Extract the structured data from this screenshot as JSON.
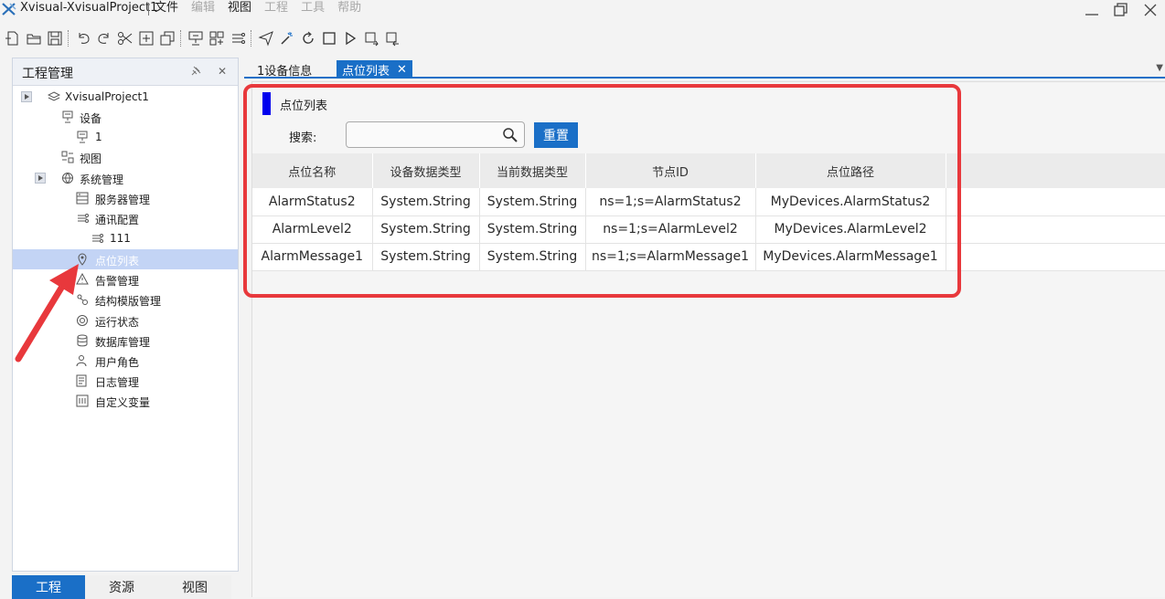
{
  "window": {
    "title": "Xvisual-XvisualProject1",
    "menus": [
      {
        "label": "文件",
        "enabled": true
      },
      {
        "label": "编辑",
        "enabled": false
      },
      {
        "label": "视图",
        "enabled": true
      },
      {
        "label": "工程",
        "enabled": false
      },
      {
        "label": "工具",
        "enabled": false
      },
      {
        "label": "帮助",
        "enabled": false
      }
    ]
  },
  "left_panel": {
    "title": "工程管理",
    "tree": [
      {
        "label": "XvisualProject1",
        "icon": "layers-icon",
        "expandable": true
      },
      {
        "label": "设备",
        "icon": "device-icon"
      },
      {
        "label": "1",
        "icon": "device-icon"
      },
      {
        "label": "视图",
        "icon": "view-icon"
      },
      {
        "label": "系统管理",
        "icon": "globe-icon",
        "expandable": true
      },
      {
        "label": "服务器管理",
        "icon": "server-icon"
      },
      {
        "label": "通讯配置",
        "icon": "link-icon"
      },
      {
        "label": "111",
        "icon": "link-icon"
      },
      {
        "label": "点位列表",
        "icon": "location-icon",
        "selected": true
      },
      {
        "label": "告警管理",
        "icon": "warning-icon"
      },
      {
        "label": "结构模版管理",
        "icon": "structure-icon"
      },
      {
        "label": "运行状态",
        "icon": "status-icon"
      },
      {
        "label": "数据库管理",
        "icon": "database-icon"
      },
      {
        "label": "用户角色",
        "icon": "user-icon"
      },
      {
        "label": "日志管理",
        "icon": "log-icon"
      },
      {
        "label": "自定义变量",
        "icon": "variable-icon"
      }
    ],
    "bottom_tabs": [
      {
        "label": "工程",
        "active": true
      },
      {
        "label": "资源",
        "active": false
      },
      {
        "label": "视图",
        "active": false
      }
    ]
  },
  "doc_tabs": [
    {
      "label": "1设备信息",
      "active": false
    },
    {
      "label": "点位列表",
      "active": true
    }
  ],
  "content": {
    "section_title": "点位列表",
    "search_label": "搜索:",
    "search_value": "",
    "reset_label": "重置",
    "table": {
      "columns": [
        "点位名称",
        "设备数据类型",
        "当前数据类型",
        "节点ID",
        "点位路径"
      ],
      "rows": [
        [
          "AlarmStatus2",
          "System.String",
          "System.String",
          "ns=1;s=AlarmStatus2",
          "MyDevices.AlarmStatus2"
        ],
        [
          "AlarmLevel2",
          "System.String",
          "System.String",
          "ns=1;s=AlarmLevel2",
          "MyDevices.AlarmLevel2"
        ],
        [
          "AlarmMessage1",
          "System.String",
          "System.String",
          "ns=1;s=AlarmMessage1",
          "MyDevices.AlarmMessage1"
        ]
      ]
    }
  },
  "colors": {
    "accent": "#1a6fc7",
    "section_marker": "#0000ee",
    "annotation_red": "#e8383c"
  }
}
